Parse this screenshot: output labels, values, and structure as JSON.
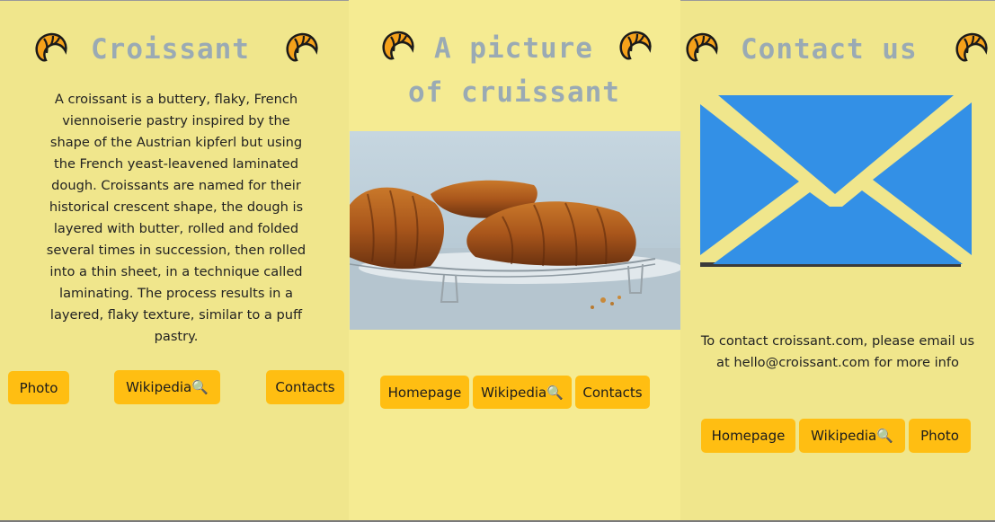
{
  "home": {
    "title": "Croissant",
    "description": "A croissant is a buttery, flaky, French viennoiserie pastry inspired by the shape of the Austrian kipferl but using the French yeast-leavened laminated dough. Croissants are named for their historical crescent shape, the dough is layered with butter, rolled and folded several times in succession, then rolled into a thin sheet, in a technique called laminating. The process results in a layered, flaky texture, similar to a puff pastry.",
    "buttons": {
      "photo": "Photo",
      "wikipedia": "Wikipedia🔍",
      "contacts": "Contacts"
    }
  },
  "picture": {
    "title_line1": "A picture",
    "title_line2": "of cruissant",
    "buttons": {
      "homepage": "Homepage",
      "wikipedia": "Wikipedia🔍",
      "contacts": "Contacts"
    }
  },
  "contact": {
    "title": "Contact us",
    "text": "To contact croissant.com, please email us at hello@croissant.com for more info",
    "buttons": {
      "homepage": "Homepage",
      "wikipedia": "Wikipedia🔍",
      "photo": "Photo"
    }
  },
  "colors": {
    "background": "#f0e68c",
    "button": "#ffbe12",
    "title": "#9aaab4",
    "envelope": "#3390e6"
  },
  "icons": [
    "croissant-icon",
    "envelope-icon"
  ]
}
